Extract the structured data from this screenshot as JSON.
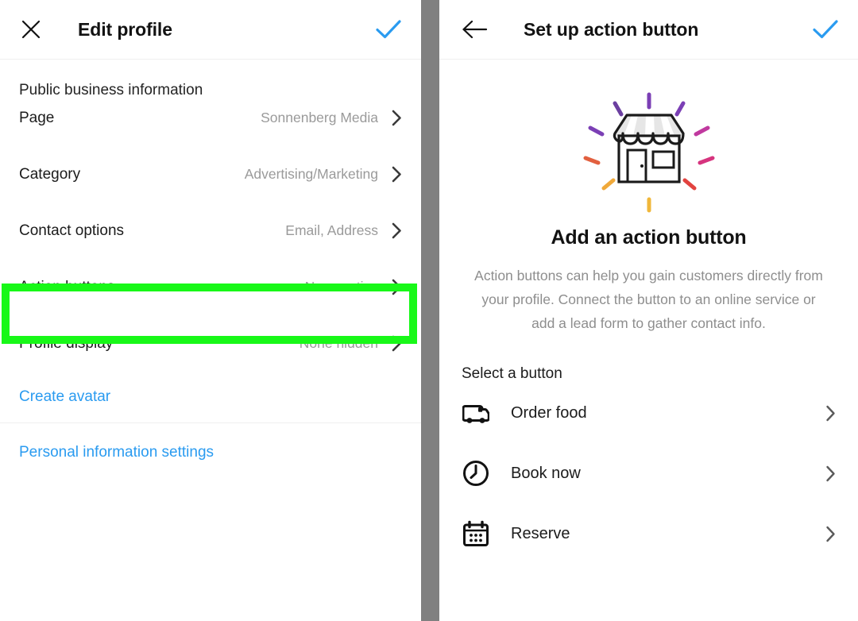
{
  "colors": {
    "accent_blue": "#2a9bf0",
    "highlight_green": "#18f818",
    "divider_gray": "#808080",
    "muted_text": "#9a9a9a",
    "body_text": "#1b1b1b"
  },
  "left_panel": {
    "header": {
      "close_icon": "close-x-icon",
      "title": "Edit profile",
      "confirm_icon": "check-icon"
    },
    "section_label": "Public business information",
    "rows": [
      {
        "label": "Page",
        "value": "Sonnenberg Media",
        "chevron": "chevron-right-icon",
        "highlighted": false
      },
      {
        "label": "Category",
        "value": "Advertising/Marketing",
        "chevron": "chevron-right-icon",
        "highlighted": false
      },
      {
        "label": "Contact options",
        "value": "Email, Address",
        "chevron": "chevron-right-icon",
        "highlighted": false
      },
      {
        "label": "Action buttons",
        "value": "None active",
        "chevron": "chevron-right-icon",
        "highlighted": true
      },
      {
        "label": "Profile display",
        "value": "None hidden",
        "chevron": "chevron-right-icon",
        "highlighted": false
      }
    ],
    "links": [
      {
        "label": "Create avatar"
      },
      {
        "label": "Personal information settings"
      }
    ]
  },
  "right_panel": {
    "header": {
      "back_icon": "arrow-left-icon",
      "title": "Set up action button",
      "confirm_icon": "check-icon"
    },
    "hero": {
      "illustration": "storefront-shop-icon",
      "title": "Add an action button",
      "body": "Action buttons can help you gain customers directly from your profile. Connect the button to an online service or add a lead form to gather contact info."
    },
    "select_label": "Select a button",
    "options": [
      {
        "label": "Order food",
        "icon": "delivery-truck-icon",
        "chevron": "chevron-right-icon"
      },
      {
        "label": "Book now",
        "icon": "clock-icon",
        "chevron": "chevron-right-icon"
      },
      {
        "label": "Reserve",
        "icon": "calendar-icon",
        "chevron": "chevron-right-icon"
      }
    ]
  }
}
